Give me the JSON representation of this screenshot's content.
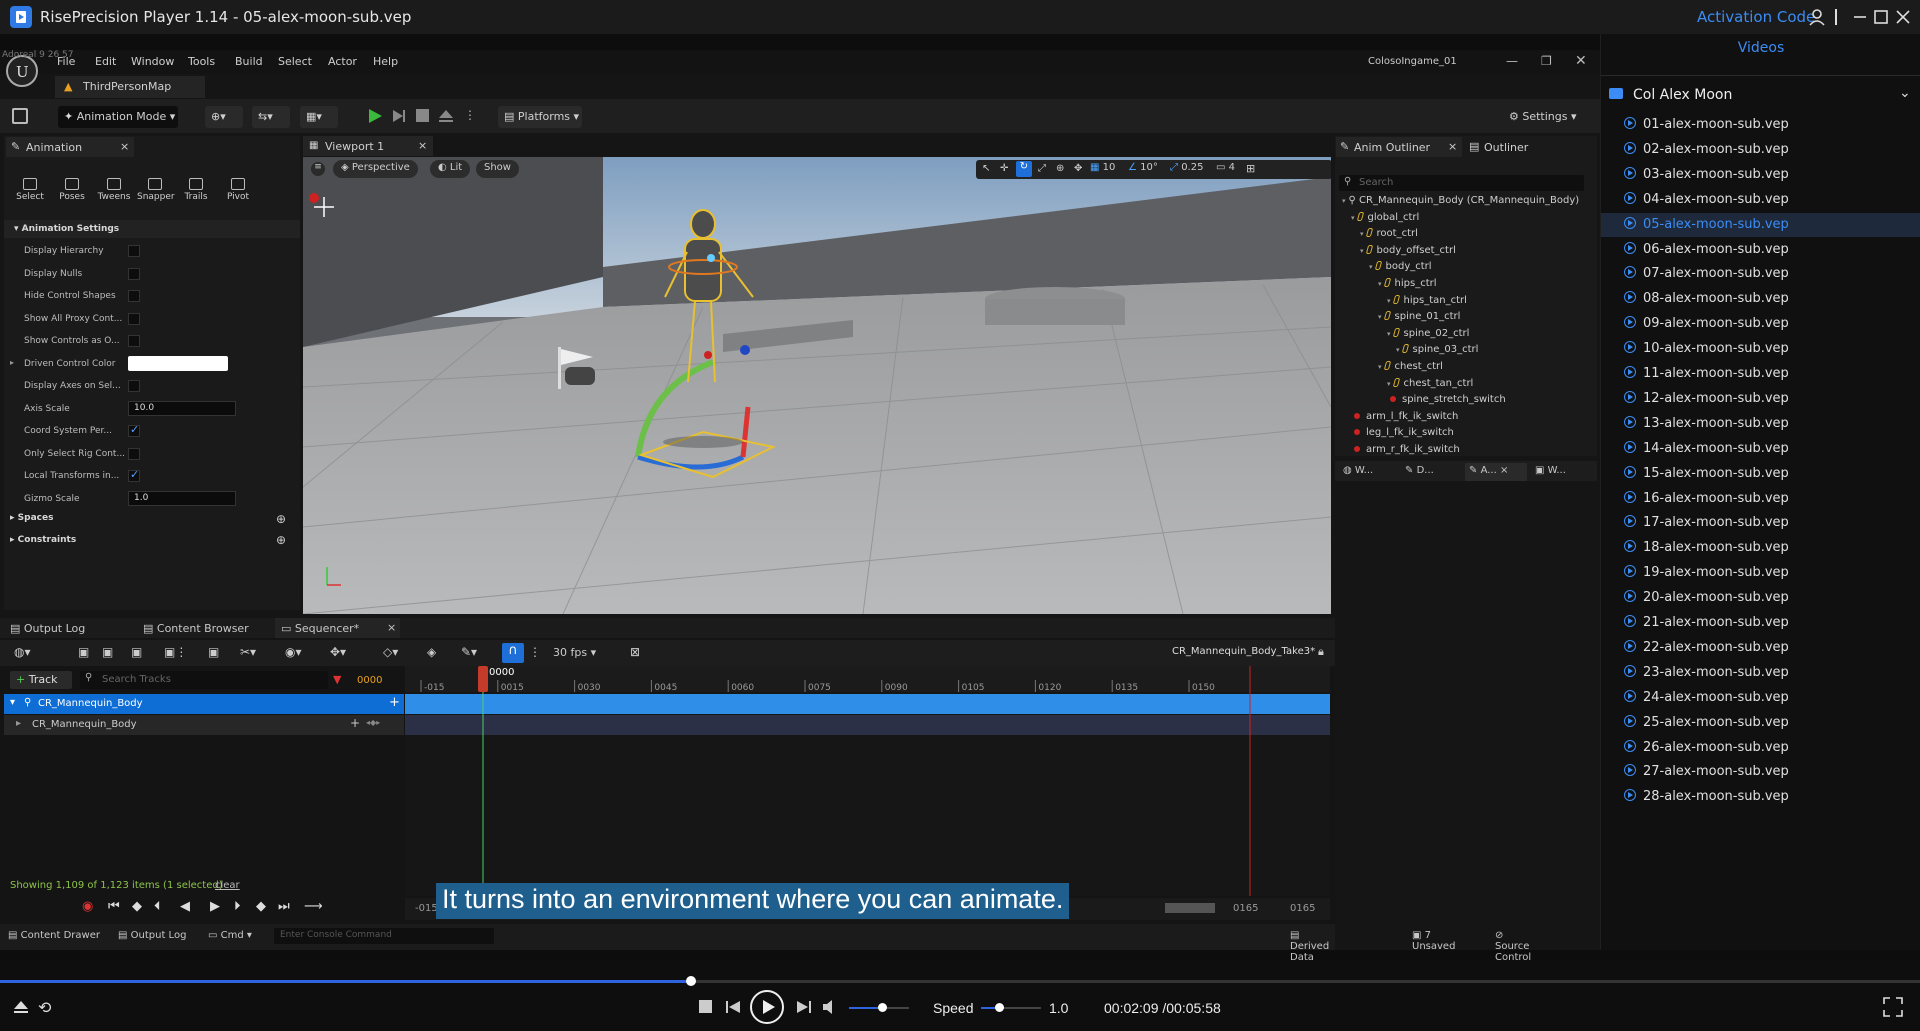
{
  "app": {
    "title": "RisePrecision Player 1.14 - 05-alex-moon-sub.vep",
    "activation_label": "Activation Code"
  },
  "ue": {
    "overlay_text": "Adoreal 9 26 57",
    "menu": [
      "File",
      "Edit",
      "Window",
      "Tools",
      "Build",
      "Select",
      "Actor",
      "Help"
    ],
    "project_name": "ColosoIngame_01",
    "map_tab": "ThirdPersonMap",
    "toolbar": {
      "mode": "Animation Mode",
      "platforms": "Platforms",
      "settings": "Settings"
    },
    "anim_panel": {
      "tab": "Animation",
      "tools": [
        "Select",
        "Poses",
        "Tweens",
        "Snapper",
        "Trails",
        "Pivot"
      ],
      "section": "Animation Settings",
      "rows": [
        {
          "label": "Display Hierarchy",
          "type": "check",
          "on": false
        },
        {
          "label": "Display Nulls",
          "type": "check",
          "on": false
        },
        {
          "label": "Hide Control Shapes",
          "type": "check",
          "on": false
        },
        {
          "label": "Show All Proxy Cont...",
          "type": "check",
          "on": false
        },
        {
          "label": "Show Controls as O...",
          "type": "check",
          "on": false
        },
        {
          "label": "Driven Control Color",
          "type": "color"
        },
        {
          "label": "Display Axes on Sel...",
          "type": "check",
          "on": false
        },
        {
          "label": "Axis Scale",
          "type": "num",
          "value": "10.0"
        },
        {
          "label": "Coord System Per...",
          "type": "check",
          "on": true
        },
        {
          "label": "Only Select Rig Cont...",
          "type": "check",
          "on": false
        },
        {
          "label": "Local Transforms in...",
          "type": "check",
          "on": true
        },
        {
          "label": "Gizmo Scale",
          "type": "num",
          "value": "1.0"
        }
      ],
      "spaces": "Spaces",
      "constraints": "Constraints"
    },
    "viewport": {
      "tab": "Viewport 1",
      "perspective": "Perspective",
      "lit": "Lit",
      "show": "Show",
      "grid": "10",
      "angle": "10°",
      "scale": "0.25",
      "cam": "4"
    },
    "outliner": {
      "tab1": "Anim Outliner",
      "tab2": "Outliner",
      "search_placeholder": "Search",
      "items": [
        {
          "label": "CR_Mannequin_Body  (CR_Mannequin_Body)",
          "indent": 0,
          "kind": "root"
        },
        {
          "label": "global_ctrl",
          "indent": 1,
          "kind": "ctl"
        },
        {
          "label": "root_ctrl",
          "indent": 2,
          "kind": "ctl"
        },
        {
          "label": "body_offset_ctrl",
          "indent": 2,
          "kind": "ctl"
        },
        {
          "label": "body_ctrl",
          "indent": 3,
          "kind": "ctl"
        },
        {
          "label": "hips_ctrl",
          "indent": 4,
          "kind": "ctl"
        },
        {
          "label": "hips_tan_ctrl",
          "indent": 5,
          "kind": "ctl"
        },
        {
          "label": "spine_01_ctrl",
          "indent": 4,
          "kind": "ctl"
        },
        {
          "label": "spine_02_ctrl",
          "indent": 5,
          "kind": "ctl"
        },
        {
          "label": "spine_03_ctrl",
          "indent": 6,
          "kind": "ctl"
        },
        {
          "label": "chest_ctrl",
          "indent": 4,
          "kind": "ctl"
        },
        {
          "label": "chest_tan_ctrl",
          "indent": 5,
          "kind": "ctl"
        },
        {
          "label": "spine_stretch_switch",
          "indent": 5,
          "kind": "sw"
        },
        {
          "label": "arm_l_fk_ik_switch",
          "indent": 1,
          "kind": "sw"
        },
        {
          "label": "leg_l_fk_ik_switch",
          "indent": 1,
          "kind": "sw"
        },
        {
          "label": "arm_r_fk_ik_switch",
          "indent": 1,
          "kind": "sw"
        }
      ],
      "bottom_tabs": [
        "W...",
        "D...",
        "A...",
        "W..."
      ]
    },
    "sequencer": {
      "tabs": [
        "Output Log",
        "Content Browser",
        "Sequencer*"
      ],
      "fps": "30 fps",
      "sequence_name": "CR_Mannequin_Body_Take3*",
      "add_track": "Track",
      "search_placeholder": "Search Tracks",
      "frame_field": "0000",
      "playhead": "0000",
      "ticks": [
        "-015",
        "0015",
        "0030",
        "0045",
        "0060",
        "0075",
        "0090",
        "0105",
        "0120",
        "0135",
        "0150"
      ],
      "tracks": [
        "CR_Mannequin_Body",
        "CR_Mannequin_Body"
      ],
      "showing": "Showing 1,109 of 1,123 items (1 selected)",
      "clear": "clear",
      "start_field": "-015",
      "end_field1": "0165",
      "end_field2": "0165"
    },
    "status": {
      "content_drawer": "Content Drawer",
      "output_log": "Output Log",
      "cmd": "Cmd",
      "console_placeholder": "Enter Console Command",
      "derived": "Derived Data",
      "unsaved": "7 Unsaved",
      "source": "Source Control"
    }
  },
  "subtitle": "It turns into an environment where you can animate.",
  "playlist": {
    "header": "Videos",
    "folder": "Col Alex Moon",
    "selected_index": 4,
    "items": [
      "01-alex-moon-sub.vep",
      "02-alex-moon-sub.vep",
      "03-alex-moon-sub.vep",
      "04-alex-moon-sub.vep",
      "05-alex-moon-sub.vep",
      "06-alex-moon-sub.vep",
      "07-alex-moon-sub.vep",
      "08-alex-moon-sub.vep",
      "09-alex-moon-sub.vep",
      "10-alex-moon-sub.vep",
      "11-alex-moon-sub.vep",
      "12-alex-moon-sub.vep",
      "13-alex-moon-sub.vep",
      "14-alex-moon-sub.vep",
      "15-alex-moon-sub.vep",
      "16-alex-moon-sub.vep",
      "17-alex-moon-sub.vep",
      "18-alex-moon-sub.vep",
      "19-alex-moon-sub.vep",
      "20-alex-moon-sub.vep",
      "21-alex-moon-sub.vep",
      "22-alex-moon-sub.vep",
      "23-alex-moon-sub.vep",
      "24-alex-moon-sub.vep",
      "25-alex-moon-sub.vep",
      "26-alex-moon-sub.vep",
      "27-alex-moon-sub.vep",
      "28-alex-moon-sub.vep"
    ]
  },
  "player": {
    "progress": 0.36,
    "volume": 0.55,
    "speed_label": "Speed",
    "speed_value": "1.0",
    "speed_fraction": 0.3,
    "time": "00:02:09 /00:05:58"
  },
  "colors": {
    "accent": "#3b8cf5",
    "track_blue": "#2f8fe8",
    "selected_row": "#1e3a5f"
  }
}
